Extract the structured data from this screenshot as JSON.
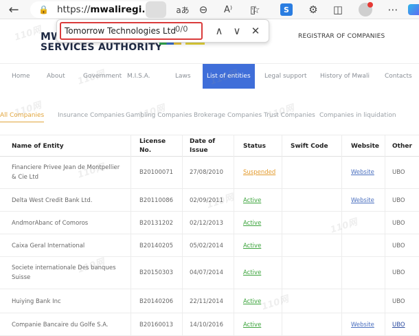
{
  "browser": {
    "url_prefix": "https://",
    "url_domain": "mwaliregi...",
    "extension_label": "S"
  },
  "find": {
    "query": "Tomorrow Technologies Ltd",
    "count": "0/0"
  },
  "site": {
    "logo_line1": "MW.",
    "logo_line2": "SERVICES AUTHORITY",
    "registrar": "REGISTRAR OF COMPANIES",
    "watermark": "110网"
  },
  "nav": [
    "Home",
    "About",
    "Government",
    "M.I.S.A.",
    "Laws",
    "List of entities",
    "Legal support",
    "History of Mwali",
    "Contacts"
  ],
  "tabs": [
    "All Companies",
    "Insurance Companies",
    "Gambling Companies",
    "Brokerage Companies",
    "Trust Companies",
    "Companies in liquidation"
  ],
  "table": {
    "headers": {
      "name": "Name of Entity",
      "license_1": "License",
      "license_2": "No.",
      "date_1": "Date of",
      "date_2": "Issue",
      "status": "Status",
      "swift": "Swift Code",
      "website": "Website",
      "other": "Other"
    },
    "rows": [
      {
        "name": "Financiere Privee Jean de Montpellier & Cie Ltd",
        "license": "B20100071",
        "date": "27/08/2010",
        "status": "Suspended",
        "website": "Website",
        "other": "UBO"
      },
      {
        "name": "Delta West Credit Bank Ltd.",
        "license": "B20110086",
        "date": "02/09/2011",
        "status": "Active",
        "website": "Website",
        "other": "UBO"
      },
      {
        "name": "AndmorAbanc of Comoros",
        "license": "B20131202",
        "date": "02/12/2013",
        "status": "Active",
        "website": "",
        "other": "UBO"
      },
      {
        "name": "Caixa Geral International",
        "license": "B20140205",
        "date": "05/02/2014",
        "status": "Active",
        "website": "",
        "other": "UBO"
      },
      {
        "name": "Societe internationale Des banques Suisse",
        "license": "B20150303",
        "date": "04/07/2014",
        "status": "Active",
        "website": "",
        "other": "UBO"
      },
      {
        "name": "Huiying Bank Inc",
        "license": "B20140206",
        "date": "22/11/2014",
        "status": "Active",
        "website": "",
        "other": "UBO"
      },
      {
        "name": "Companie Bancaire du Golfe S.A.",
        "license": "B20160013",
        "date": "14/10/2016",
        "status": "Active",
        "website": "Website",
        "other": "UBO"
      }
    ]
  }
}
